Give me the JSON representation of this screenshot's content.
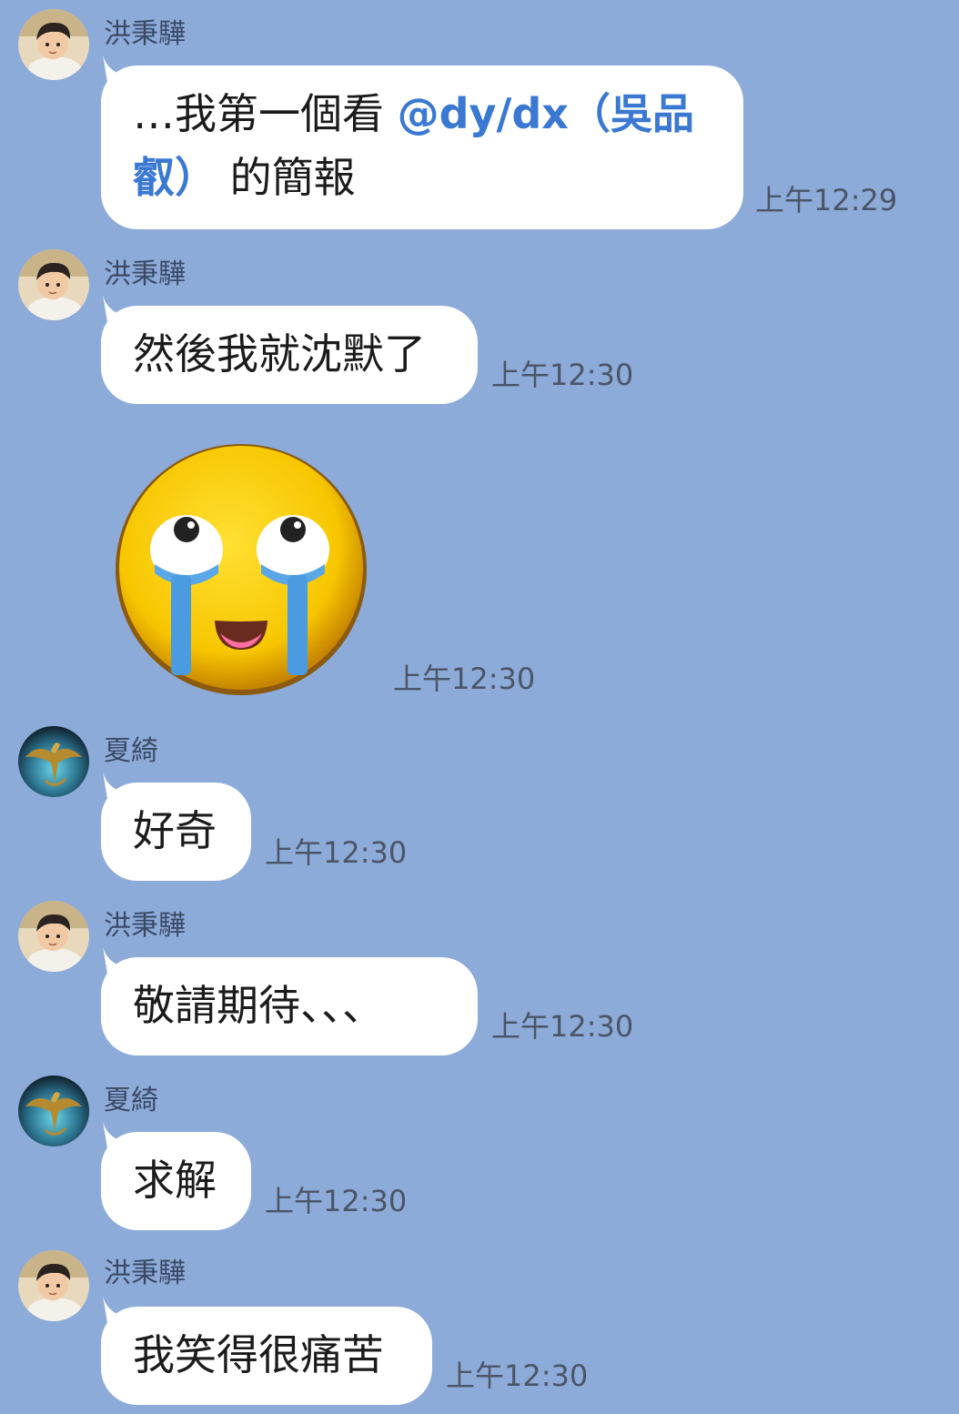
{
  "messages": [
    {
      "sender": "洪秉驊",
      "avatar": "avatar-boy",
      "text_pre": "…我第一個看 ",
      "mention": "@dy/dx（吳品",
      "mention_line2": "叡）",
      "text_post": " 的簡報",
      "time": "上午12:29"
    },
    {
      "sender": "洪秉驊",
      "avatar": "avatar-boy",
      "text": "然後我就沈默了",
      "time": "上午12:30"
    },
    {
      "type": "sticker",
      "sticker": "crying-laughing-face",
      "time": "上午12:30"
    },
    {
      "sender": "夏綺",
      "avatar": "avatar-dragon",
      "text": "好奇",
      "time": "上午12:30"
    },
    {
      "sender": "洪秉驊",
      "avatar": "avatar-boy",
      "text": "敬請期待、、、",
      "time": "上午12:30"
    },
    {
      "sender": "夏綺",
      "avatar": "avatar-dragon",
      "text": "求解",
      "time": "上午12:30"
    },
    {
      "sender": "洪秉驊",
      "avatar": "avatar-boy",
      "text": "我笑得很痛苦",
      "time": "上午12:30"
    }
  ],
  "colors": {
    "background": "#8dabd8",
    "bubble": "#ffffff",
    "mention": "#3a78d2"
  }
}
